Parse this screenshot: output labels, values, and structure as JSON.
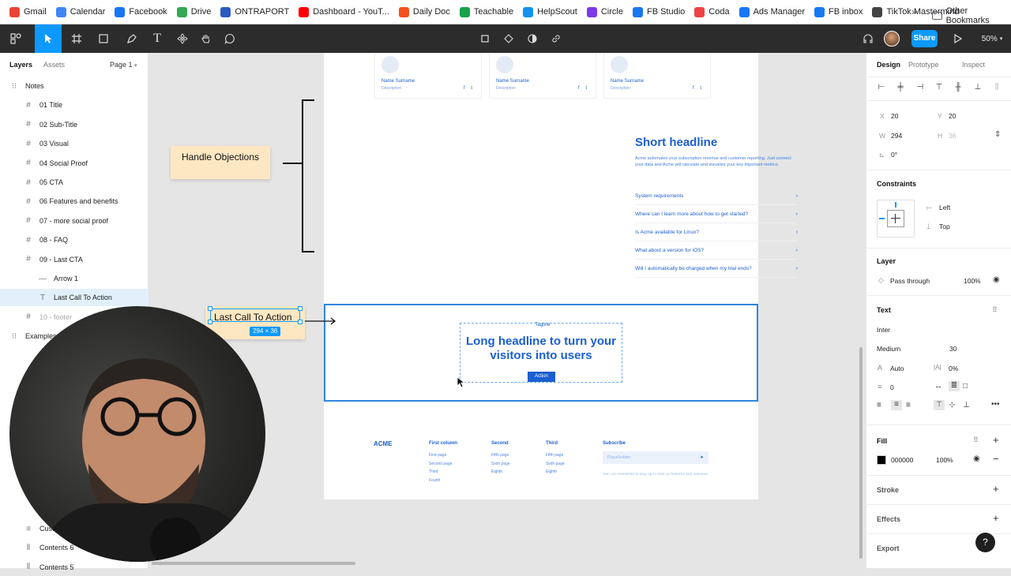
{
  "bookmarks": {
    "items": [
      {
        "label": "Gmail",
        "color": "#ea4335"
      },
      {
        "label": "Calendar",
        "color": "#4285f4"
      },
      {
        "label": "Facebook",
        "color": "#1877f2"
      },
      {
        "label": "Drive",
        "color": "#34a853"
      },
      {
        "label": "ONTRAPORT",
        "color": "#2b59c3"
      },
      {
        "label": "Dashboard - YouT...",
        "color": "#ff0000"
      },
      {
        "label": "Daily Doc",
        "color": "#f4511e"
      },
      {
        "label": "Teachable",
        "color": "#16a34a"
      },
      {
        "label": "HelpScout",
        "color": "#1292ee"
      },
      {
        "label": "Circle",
        "color": "#7c3aed"
      },
      {
        "label": "FB Studio",
        "color": "#1877f2"
      },
      {
        "label": "Coda",
        "color": "#ef4444"
      },
      {
        "label": "Ads Manager",
        "color": "#1877f2"
      },
      {
        "label": "FB inbox",
        "color": "#1877f2"
      },
      {
        "label": "TikTok Mastermind",
        "color": "#444444"
      }
    ],
    "more": "»",
    "other": "Other Bookmarks"
  },
  "toolbar": {
    "share_label": "Share",
    "zoom": "50%"
  },
  "left_panel": {
    "tab_layers": "Layers",
    "tab_assets": "Assets",
    "page": "Page 1",
    "layers": [
      {
        "label": "Notes",
        "icon": "frame-icon",
        "indent": 0
      },
      {
        "label": "01 Title",
        "icon": "hash-icon",
        "indent": 1
      },
      {
        "label": "02 Sub-Title",
        "icon": "hash-icon",
        "indent": 1
      },
      {
        "label": "03 Visual",
        "icon": "hash-icon",
        "indent": 1
      },
      {
        "label": "04 Social Proof",
        "icon": "hash-icon",
        "indent": 1
      },
      {
        "label": "05 CTA",
        "icon": "hash-icon",
        "indent": 1
      },
      {
        "label": "06 Features and benefits",
        "icon": "hash-icon",
        "indent": 1
      },
      {
        "label": "07 - more social proof",
        "icon": "hash-icon",
        "indent": 1
      },
      {
        "label": "08 - FAQ",
        "icon": "hash-icon",
        "indent": 1
      },
      {
        "label": "09 - Last CTA",
        "icon": "hash-icon",
        "indent": 1
      },
      {
        "label": "Arrow 1",
        "icon": "line-icon",
        "indent": 2
      },
      {
        "label": "Last Call To Action",
        "icon": "text-icon",
        "indent": 2,
        "selected": true
      },
      {
        "label": "10 - footer",
        "icon": "hash-icon",
        "indent": 1,
        "dim": true
      },
      {
        "label": "Examples",
        "icon": "frame-icon",
        "indent": 0
      }
    ],
    "bottom_layers": [
      {
        "label": "Cust",
        "icon": "list-icon"
      },
      {
        "label": "Contents 6",
        "icon": "bars-icon"
      },
      {
        "label": "Contents 5",
        "icon": "bars-icon"
      }
    ]
  },
  "canvas": {
    "cards": [
      {
        "name": "Name Surname",
        "desc": "Description"
      },
      {
        "name": "Name Surname",
        "desc": "Description"
      },
      {
        "name": "Name Surname",
        "desc": "Description"
      }
    ],
    "faq_title": "Short headline",
    "faq_desc": "Acme automates your subscription revenue and customer reporting. Just connect your data and Acme will calculate and visualize your key important metrics.",
    "faq_items": [
      "System requirements",
      "Where can I learn more about how to get started?",
      "Is Acme available for Linux?",
      "What about a version for iOS?",
      "Will I automatically be charged when my trial ends?"
    ],
    "tagline": "Tagline",
    "cta_headline": "Long headline to turn your visitors into users",
    "cta_button": "Action",
    "footer": {
      "logo": "ACME",
      "columns": [
        {
          "title": "First column",
          "items": [
            "First page",
            "Second page",
            "Third",
            "Fourth"
          ]
        },
        {
          "title": "Second",
          "items": [
            "Fifth page",
            "Sixth page",
            "Eighth"
          ]
        },
        {
          "title": "Third",
          "items": [
            "Fifth page",
            "Sixth page",
            "Eighth"
          ]
        }
      ],
      "subscribe_title": "Subscribe",
      "subscribe_placeholder": "Placeholder",
      "subscribe_note": "Join our newsletter to stay up to date on features and releases."
    },
    "note_handle": "Handle Objections",
    "note_last": "Last Call To Action",
    "dim_label": "294 × 36"
  },
  "right_panel": {
    "tab_design": "Design",
    "tab_prototype": "Prototype",
    "tab_inspect": "Inspect",
    "x_label": "X",
    "x_val": "20",
    "y_label": "Y",
    "y_val": "20",
    "w_label": "W",
    "w_val": "294",
    "h_label": "H",
    "h_val": "36",
    "rotation": "0°",
    "constraints_title": "Constraints",
    "constraint_h": "Left",
    "constraint_v": "Top",
    "layer_title": "Layer",
    "blend": "Pass through",
    "opacity": "100%",
    "text_title": "Text",
    "font": "Inter",
    "weight": "Medium",
    "size": "30",
    "line_height": "Auto",
    "letter_spacing": "0%",
    "para_spacing": "0",
    "fill_title": "Fill",
    "fill_hex": "000000",
    "fill_opacity": "100%",
    "stroke_title": "Stroke",
    "effects_title": "Effects",
    "export_title": "Export",
    "help": "?"
  }
}
